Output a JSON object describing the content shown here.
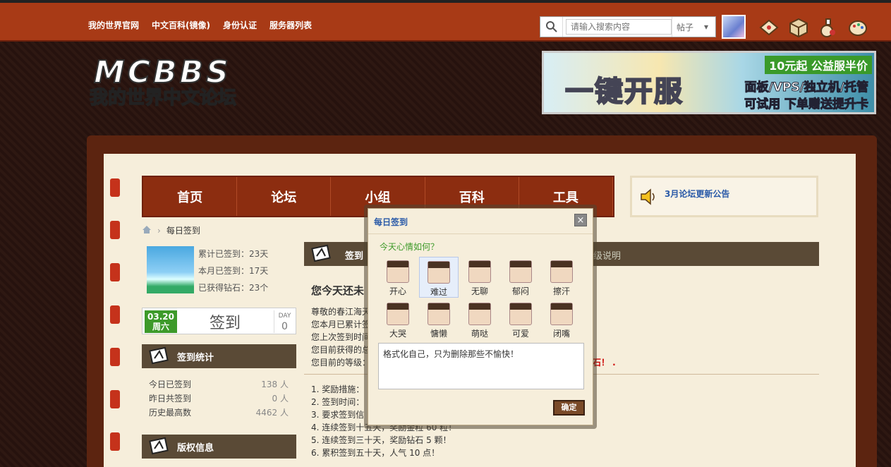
{
  "topnav": [
    "我的世界官网",
    "中文百科(镜像)",
    "身份认证",
    "服务器列表"
  ],
  "search": {
    "placeholder": "请输入搜索内容",
    "scope": "帖子"
  },
  "logo": {
    "text1": "MCBBS",
    "text2": "我的世界中文论坛"
  },
  "banner": {
    "price": "10元起 公益服半价",
    "big": "一键开服",
    "line2": "面板/VPS/独立机/托管",
    "line3": "可试用 下单赠送提升卡"
  },
  "mainnav": [
    "首页",
    "论坛",
    "小组",
    "百科",
    "工具"
  ],
  "notice": "3月论坛更新公告",
  "breadcrumb": {
    "current": "每日签到"
  },
  "user_stats": [
    {
      "label": "累计已签到：",
      "value": "23天"
    },
    {
      "label": "本月已签到：",
      "value": "17天"
    },
    {
      "label": "已获得钻石：",
      "value": "23个"
    }
  ],
  "signin": {
    "date": "03.20",
    "weekday": "周六",
    "button": "签到",
    "day_label": "DAY",
    "day_value": "0"
  },
  "stats_section": {
    "title": "签到统计",
    "rows": [
      {
        "label": "今日已签到",
        "value": "138 人"
      },
      {
        "label": "昨日共签到",
        "value": "0 人"
      },
      {
        "label": "历史最高数",
        "value": "4462 人"
      }
    ]
  },
  "copyright_title": "版权信息",
  "main": {
    "head_title": "签到",
    "head_right": "级说明",
    "greeting": "您今天还未",
    "lines": [
      "尊敬的春江海天",
      "您本月已累计签",
      "您上次签到时间",
      "您目前获得的总",
      "您目前的等级："
    ],
    "rules": [
      "1. 奖励措施：",
      "2. 签到时间：",
      "3. 要求签到信",
      "4. 连续签到十五天，奖励金粒 60 粒！",
      "5. 连续签到三十天，奖励钻石 5 颗！",
      "6. 累积签到五十天，人气 10 点！"
    ],
    "trailing": "石！ ."
  },
  "dialog": {
    "title": "每日签到",
    "close": "×",
    "question": "今天心情如何？",
    "moods": [
      "开心",
      "难过",
      "无聊",
      "郁闷",
      "擦汗",
      "大哭",
      "慵懒",
      "萌哒",
      "可爱",
      "闭嘴"
    ],
    "selected_mood": "难过",
    "message": "格式化自己，只为删除那些不愉快！",
    "confirm": "确定"
  },
  "colors": {
    "topbar": "#a83a16",
    "nav": "#8c2d10",
    "accent_green": "#3d9a2a",
    "link_blue": "#2a5aa8"
  }
}
